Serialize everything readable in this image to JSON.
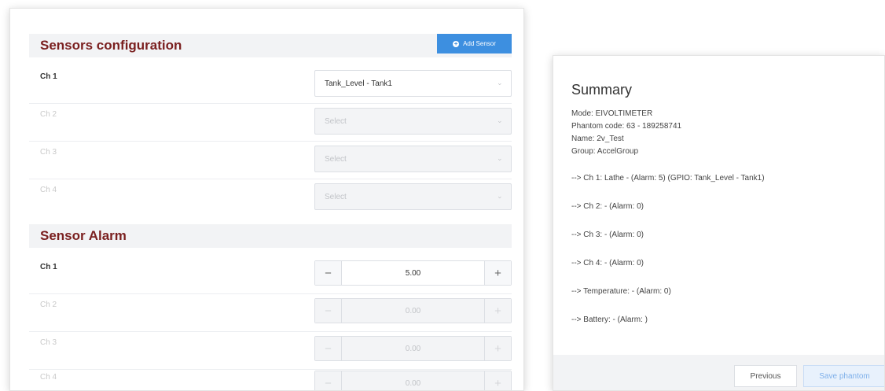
{
  "sensors": {
    "title": "Sensors configuration",
    "add_button": "Add Sensor",
    "channels": [
      {
        "label": "Ch 1",
        "value": "Tank_Level - Tank1",
        "disabled": false
      },
      {
        "label": "Ch 2",
        "value": "Select",
        "disabled": true
      },
      {
        "label": "Ch 3",
        "value": "Select",
        "disabled": true
      },
      {
        "label": "Ch 4",
        "value": "Select",
        "disabled": true
      }
    ]
  },
  "alarm": {
    "title": "Sensor Alarm",
    "minus": "−",
    "plus": "+",
    "channels": [
      {
        "label": "Ch 1",
        "value": "5.00",
        "disabled": false
      },
      {
        "label": "Ch 2",
        "value": "0.00",
        "disabled": true
      },
      {
        "label": "Ch 3",
        "value": "0.00",
        "disabled": true
      },
      {
        "label": "Ch 4",
        "value": "0.00",
        "disabled": true
      }
    ]
  },
  "summary": {
    "title": "Summary",
    "mode": "Mode: EIVOLTIMETER",
    "phantom_code": "Phantom code: 63 - 189258741",
    "name": "Name: 2v_Test",
    "group": "Group: AccelGroup",
    "lines": [
      "--> Ch 1: Lathe - (Alarm: 5) (GPIO: Tank_Level - Tank1)",
      "--> Ch 2: - (Alarm: 0)",
      "--> Ch 3: - (Alarm: 0)",
      "--> Ch 4: - (Alarm: 0)",
      "--> Temperature: - (Alarm: 0)",
      "--> Battery: - (Alarm: )"
    ],
    "previous_button": "Previous",
    "save_button": "Save phantom"
  },
  "colors": {
    "section_title": "#7a1f1f",
    "accent": "#3d8fe0",
    "save_button_bg": "#e8f1fc"
  }
}
